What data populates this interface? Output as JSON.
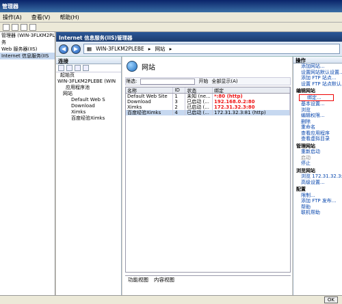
{
  "window": {
    "title": "管理器"
  },
  "menu": [
    "操作(A)",
    "查看(V)",
    "帮助(H)"
  ],
  "mmc_tree": [
    "管理器 (WIN-3FLKM2PLEBS)",
    "务",
    "Web 服务器(IIS)",
    "Internet 信息服务(IIS"
  ],
  "iis": {
    "title": "Internet 信息服务(IIS)管理器"
  },
  "address": {
    "server": "WIN-3FLKM2PLEBE",
    "node": "网站"
  },
  "connections": {
    "title": "连接",
    "tree": [
      "起始页",
      "WIN-3FLKM2PLEBE (WIN",
      "应用程序池",
      "网站",
      "Default Web S",
      "Download",
      "Ximks",
      "百度经验Ximks"
    ]
  },
  "center": {
    "title": "网站",
    "filter_label": "筛选:",
    "go": "开始",
    "show_all": "全部显示(A)",
    "columns": [
      "名称",
      "ID",
      "状态",
      "绑定"
    ],
    "rows": [
      {
        "name": "Default Web Site",
        "id": "1",
        "status": "未知 (ne...",
        "binding": "*:80 (http)"
      },
      {
        "name": "Download",
        "id": "3",
        "status": "已启动 (...",
        "binding": "192.168.0.2:80"
      },
      {
        "name": "Ximks",
        "id": "2",
        "status": "已启动 (...",
        "binding": "172.31.32.3:80"
      },
      {
        "name": "百度经验Ximks",
        "id": "4",
        "status": "已启动 (...",
        "binding": "172.31.32.3:81 (http)"
      }
    ],
    "tabs": [
      "功能视图",
      "内容视图"
    ]
  },
  "actions": {
    "title": "操作",
    "group1": [
      "添加网站...",
      "设置网站默认设置...",
      "添加 FTP 站点...",
      "设置 FTP 站点默认..."
    ],
    "edit_title": "编辑网站",
    "bindings": "绑定...",
    "basic": "基本设置...",
    "browse": "浏览",
    "perms": "编辑权限...",
    "delete": "删除",
    "rename": "重命名",
    "view_apps": "查看应用程序",
    "view_vdirs": "查看虚拟目录",
    "manage_title": "管理网站",
    "restart": "重新启动",
    "start": "启动",
    "stop": "停止",
    "browse_title": "浏览网站",
    "browse_link": "浏览 172.31.32.3:81 (http)",
    "advanced": "高级设置...",
    "config_title": "配置",
    "limits": "限制...",
    "add_ftp": "添加 FTP 发布...",
    "help": "帮助",
    "online_help": "联机帮助"
  },
  "status": {
    "ok": "OK"
  }
}
